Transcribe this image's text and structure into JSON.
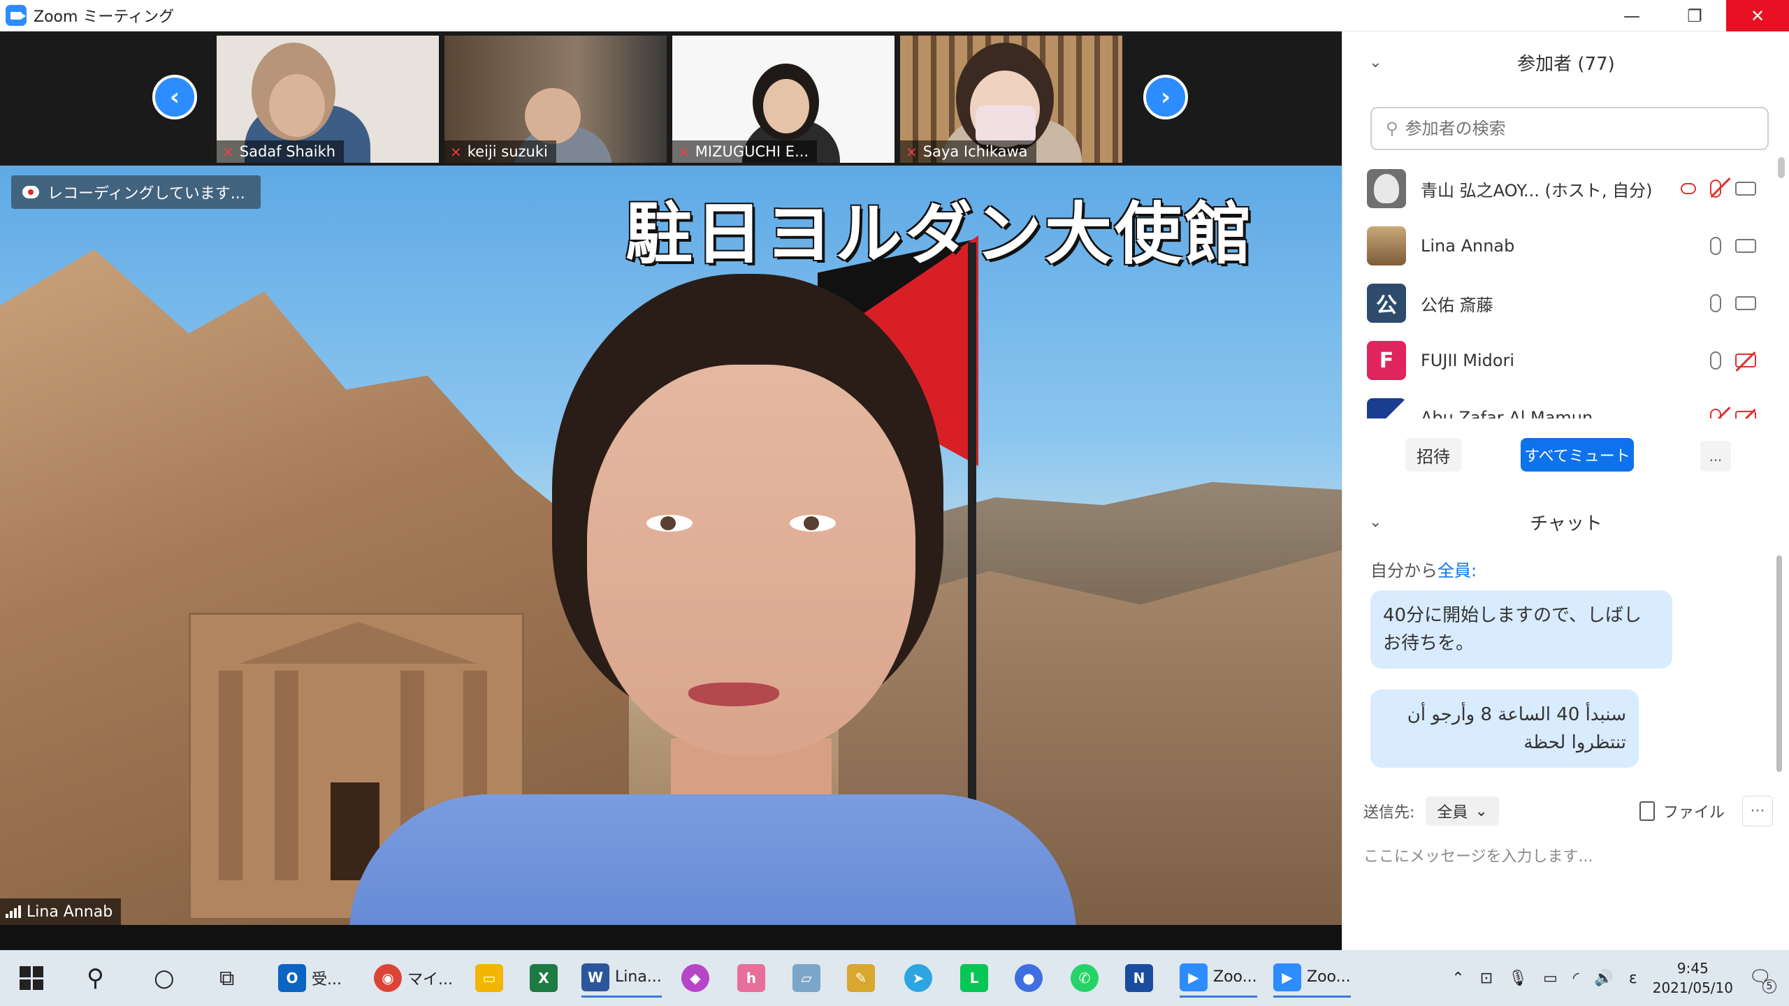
{
  "window": {
    "title": "Zoom ミーティング"
  },
  "thumbnails": [
    {
      "name": "Sadaf Shaikh",
      "muted": true
    },
    {
      "name": "keiji suzuki",
      "muted": true
    },
    {
      "name": "MIZUGUCHI E...",
      "muted": true
    },
    {
      "name": "Saya Ichikawa",
      "muted": true
    }
  ],
  "main_video": {
    "recording_label": "レコーディングしています...",
    "banner_title": "駐日ヨルダン大使館",
    "speaker_name": "Lina Annab"
  },
  "participants_panel": {
    "header": "参加者 (77)",
    "search_placeholder": "参加者の検索",
    "items": [
      {
        "name": "青山 弘之AOY... (ホスト, 自分)",
        "avatar_color": "#8a8a8a",
        "avatar_letter": "",
        "mic": "off",
        "video": "on",
        "recording": true
      },
      {
        "name": "Lina Annab",
        "avatar_color": "#9c7b52",
        "avatar_letter": "",
        "mic": "on",
        "video": "on",
        "recording": false
      },
      {
        "name": "公佑 斎藤",
        "avatar_color": "#2e4b6b",
        "avatar_letter": "公",
        "mic": "on",
        "video": "on",
        "recording": false
      },
      {
        "name": "FUJII Midori",
        "avatar_color": "#e0245e",
        "avatar_letter": "F",
        "mic": "on",
        "video": "off",
        "recording": false
      },
      {
        "name": "Abu Zafar Al Mamun",
        "avatar_color": "#1b3d8f",
        "avatar_letter": "",
        "mic": "off",
        "video": "off",
        "recording": false
      }
    ],
    "invite_label": "招待",
    "mute_all_label": "すべてミュート",
    "more_label": "..."
  },
  "chat_panel": {
    "header": "チャット",
    "from_label": "自分から",
    "to_label": "全員:",
    "messages": [
      "40分に開始しますので、しばしお待ちを。",
      "سنبدأ 40 الساعة 8 وأرجو أن تنتظروا لحظة"
    ],
    "send_to_label": "送信先:",
    "send_to_value": "全員",
    "file_label": "ファイル",
    "input_placeholder": "ここにメッセージを入力します..."
  },
  "taskbar": {
    "apps": [
      {
        "label": "受...",
        "color": "#0a64c2"
      },
      {
        "label": "マイ...",
        "color": "#db4437"
      },
      {
        "label": "",
        "color": "#f2b600"
      },
      {
        "label": "",
        "color": "#1d7a43"
      },
      {
        "label": "Lina...",
        "color": "#2b579a"
      },
      {
        "label": "",
        "color": "#b446c7"
      },
      {
        "label": "",
        "color": "#e86f9a"
      },
      {
        "label": "",
        "color": "#7aa7c9"
      },
      {
        "label": "",
        "color": "#d9a62e"
      },
      {
        "label": "",
        "color": "#2ca5e0"
      },
      {
        "label": "",
        "color": "#06c755"
      },
      {
        "label": "",
        "color": "#3d6fe0"
      },
      {
        "label": "",
        "color": "#25d366"
      },
      {
        "label": "",
        "color": "#1a4d9e"
      },
      {
        "label": "Zoo...",
        "color": "#2d8cff"
      },
      {
        "label": "Zoo...",
        "color": "#2d8cff"
      }
    ],
    "time": "9:45",
    "date": "2021/05/10",
    "notification_count": "5"
  }
}
